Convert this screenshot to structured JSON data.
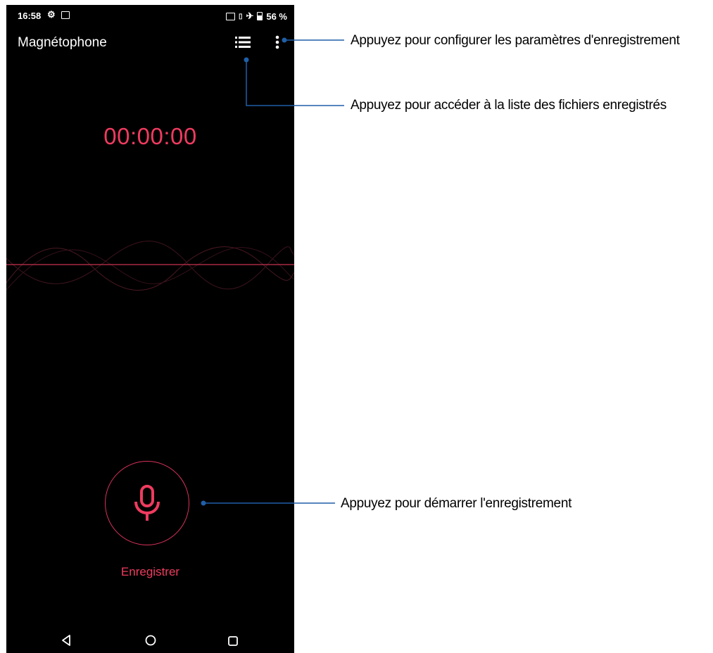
{
  "status_bar": {
    "time": "16:58",
    "battery": "56 %",
    "icons": [
      "gear-icon",
      "image-icon",
      "nfc-icon",
      "vibrate-icon",
      "airplane-icon",
      "battery-icon"
    ]
  },
  "app": {
    "title": "Magnétophone",
    "timer": "00:00:00",
    "record_label": "Enregistrer",
    "accent_color": "#ef3b5f",
    "background_color": "#000000"
  },
  "toolbar": {
    "list_icon": "list-icon",
    "more_icon": "more-vertical-icon"
  },
  "nav_bar": {
    "icons": [
      "back-icon",
      "home-icon",
      "recents-icon"
    ]
  },
  "callouts": {
    "settings": "Appuyez pour configurer les paramètres d'enregistrement",
    "file_list": "Appuyez pour accéder à la liste des fichiers enregistrés",
    "record": "Appuyez pour démarrer l'enregistrement",
    "line_color": "#1f5fa8"
  }
}
